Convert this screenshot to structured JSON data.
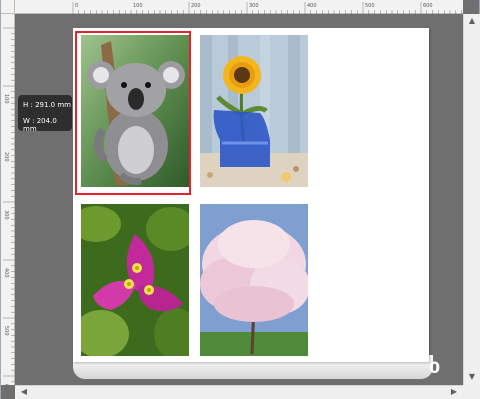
{
  "ruler": {
    "horizontal_labels": [
      "0",
      "100",
      "200",
      "300",
      "400",
      "500",
      "600"
    ],
    "vertical_labels": [
      "100",
      "200",
      "300",
      "400",
      "500",
      "600"
    ]
  },
  "tooltip": {
    "height_text": "H : 291.0 mm",
    "width_text": "W : 204.0 mm"
  },
  "photos": [
    {
      "subject": "koala",
      "selected": true
    },
    {
      "subject": "sunflower",
      "selected": false
    },
    {
      "subject": "bougainvillea",
      "selected": false
    },
    {
      "subject": "cherry-blossom-tree",
      "selected": false
    }
  ],
  "paper_end_mark": "0",
  "colors": {
    "selection": "#e5232a",
    "canvas": "#6f6f6f",
    "tooltip_bg": "#2e2e2e"
  }
}
